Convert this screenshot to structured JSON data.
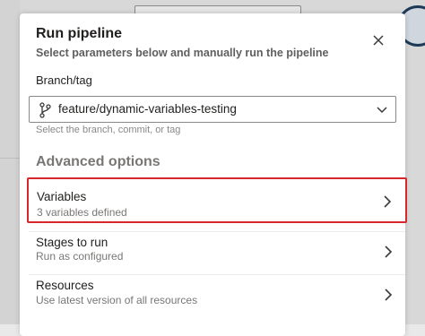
{
  "dialog": {
    "title": "Run pipeline",
    "subtitle": "Select parameters below and manually run the pipeline",
    "close_icon": "close-icon"
  },
  "branch": {
    "label": "Branch/tag",
    "value": "feature/dynamic-variables-testing",
    "help": "Select the branch, commit, or tag",
    "icon": "git-branch-icon"
  },
  "advanced": {
    "title": "Advanced options",
    "options": [
      {
        "title": "Variables",
        "subtitle": "3 variables defined"
      },
      {
        "title": "Stages to run",
        "subtitle": "Run as configured"
      },
      {
        "title": "Resources",
        "subtitle": "Use latest version of all resources"
      }
    ]
  },
  "colors": {
    "highlight": "#d6272d",
    "text": "#201f1e",
    "secondary_text": "#797775"
  }
}
